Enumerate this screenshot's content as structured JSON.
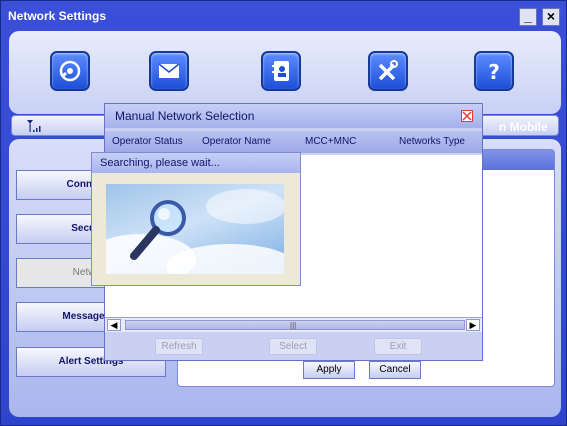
{
  "window": {
    "title": "Network Settings"
  },
  "toolbar": {
    "icons": [
      "connection-icon",
      "message-icon",
      "phonebook-icon",
      "settings-icon",
      "help-icon"
    ]
  },
  "signal": {
    "operator": "n Mobile"
  },
  "nav": {
    "items": [
      {
        "label": "Connectio"
      },
      {
        "label": "Security"
      },
      {
        "label": "Network"
      },
      {
        "label": "Message Se"
      },
      {
        "label": "Alert Settings"
      }
    ]
  },
  "actions": {
    "apply": "Apply",
    "cancel": "Cancel"
  },
  "dialog": {
    "title": "Manual Network Selection",
    "columns": [
      "Operator Status",
      "Operator Name",
      "MCC+MNC",
      "Networks Type"
    ],
    "buttons": {
      "refresh": "Refresh",
      "select": "Select",
      "exit": "Exit"
    },
    "scroll_grip": "|||"
  },
  "popup": {
    "title": "Searching, please wait..."
  },
  "colors": {
    "accent": "#2f44cc",
    "panel": "#c9d0f2",
    "close_red": "#e03a3a"
  }
}
